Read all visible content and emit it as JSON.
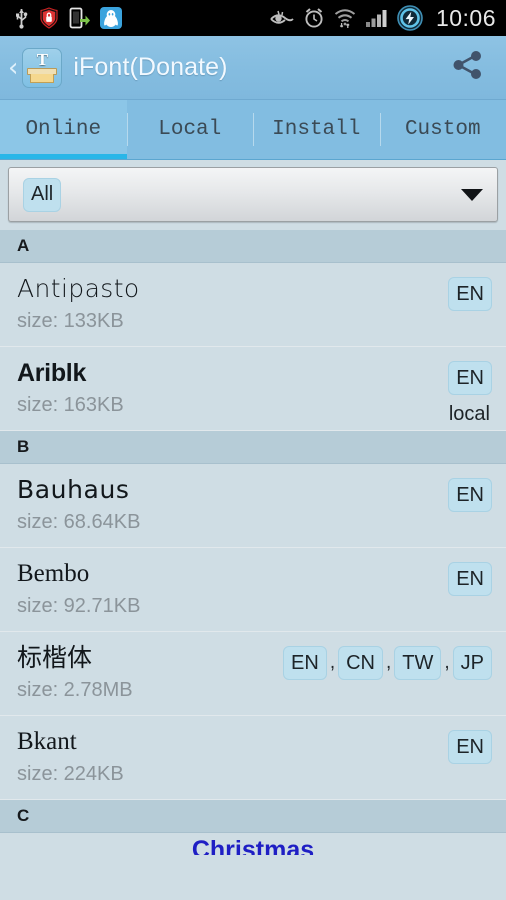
{
  "status_bar": {
    "time": "10:06",
    "left_icons": [
      "usb-icon",
      "security-shield-icon",
      "phone-transfer-icon",
      "qq-penguin-icon"
    ],
    "right_icons": [
      "eye-icon",
      "alarm-clock-icon",
      "wifi-data-icon",
      "signal-bars-icon",
      "charging-battery-icon"
    ]
  },
  "action_bar": {
    "back_label": "‹",
    "app_icon_letter": "T",
    "title": "iFont(Donate)",
    "share_icon": "share-icon"
  },
  "tabs": [
    {
      "label": "Online",
      "active": true
    },
    {
      "label": "Local",
      "active": false
    },
    {
      "label": "Install",
      "active": false
    },
    {
      "label": "Custom",
      "active": false
    }
  ],
  "filter": {
    "selected": "All",
    "caret": "chevron-down-icon"
  },
  "list": [
    {
      "type": "section",
      "label": "A"
    },
    {
      "type": "font",
      "name": "Antipasto",
      "size": "size: 133KB",
      "badges": [
        "EN"
      ],
      "status": "",
      "style": "ff-thin"
    },
    {
      "type": "font",
      "name": "Ariblk",
      "size": "size: 163KB",
      "badges": [
        "EN"
      ],
      "status": "local",
      "style": "ff-bold"
    },
    {
      "type": "section",
      "label": "B"
    },
    {
      "type": "font",
      "name": "Bauhaus",
      "size": "size: 68.64KB",
      "badges": [
        "EN"
      ],
      "status": "",
      "style": "ff-round"
    },
    {
      "type": "font",
      "name": "Bembo",
      "size": "size: 92.71KB",
      "badges": [
        "EN"
      ],
      "status": "",
      "style": "ff-serif"
    },
    {
      "type": "font",
      "name": "标楷体",
      "size": "size: 2.78MB",
      "badges": [
        "EN",
        "CN",
        "TW",
        "JP"
      ],
      "status": "",
      "style": "ff-cjk"
    },
    {
      "type": "font",
      "name": "Bkant",
      "size": "size: 224KB",
      "badges": [
        "EN"
      ],
      "status": "",
      "style": "ff-serif"
    },
    {
      "type": "section",
      "label": "C"
    },
    {
      "type": "font-partial",
      "name": "Christmas",
      "size": "",
      "badges": [],
      "status": "",
      "style": "ff-xmas"
    }
  ],
  "colors": {
    "accent": "#29b6e8",
    "action_bar": "#85bde0",
    "tab_bar": "#82bde1",
    "list_bg": "#cfdde4",
    "section_bg": "#b6ccd7",
    "badge_bg": "#bfe0ee",
    "status_bar": "#000000",
    "xmas_text": "#1f1fc4"
  }
}
